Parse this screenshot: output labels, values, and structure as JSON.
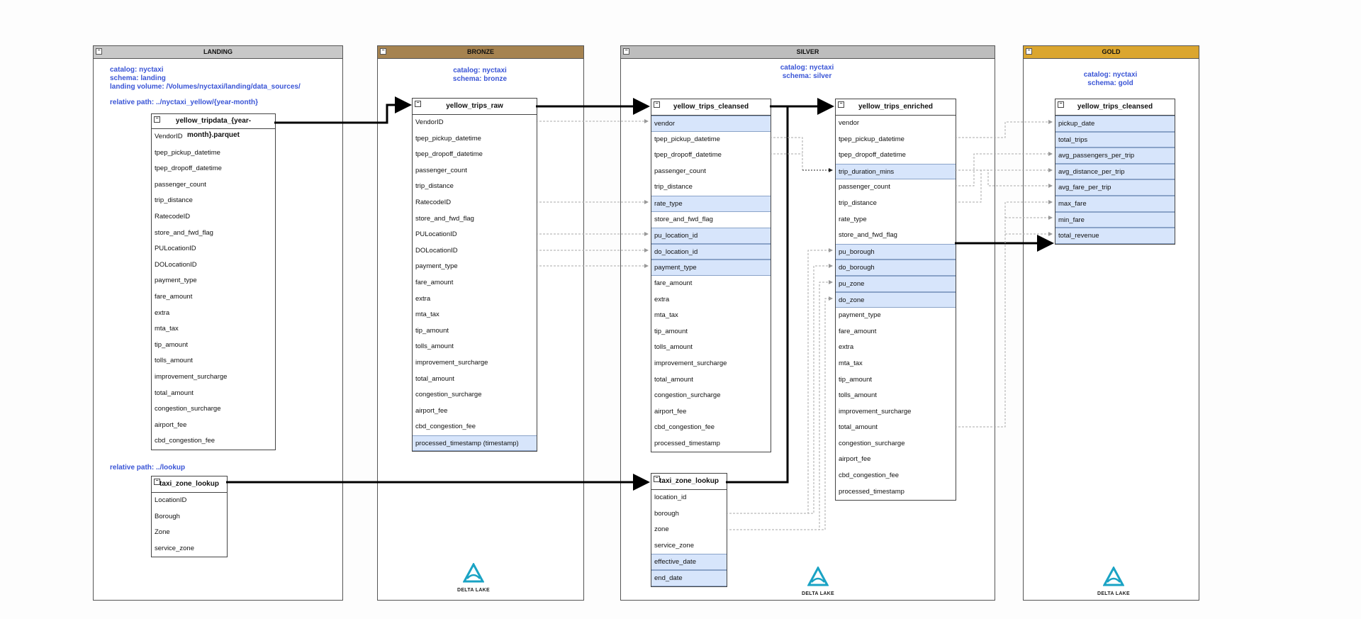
{
  "lanes": {
    "landing": {
      "title": "LANDING"
    },
    "bronze": {
      "title": "BRONZE"
    },
    "silver": {
      "title": "SILVER"
    },
    "gold": {
      "title": "GOLD"
    }
  },
  "landing": {
    "catalog": "catalog: nyctaxi",
    "schema": "schema: landing",
    "volume": "landing volume: /Volumes/nyctaxi/landing/data_sources/",
    "path_yellow": "relative path: ../nyctaxi_yellow/{year-month}",
    "path_lookup": "relative path: ../lookup"
  },
  "bronze": {
    "catalog": "catalog: nyctaxi",
    "schema": "schema: bronze"
  },
  "silver": {
    "catalog": "catalog: nyctaxi",
    "schema": "schema: silver"
  },
  "gold": {
    "catalog": "catalog: nyctaxi",
    "schema": "schema: gold"
  },
  "delta_lake": "DELTA LAKE",
  "tables": {
    "landing_yellow": {
      "title": "yellow_tripdata_{year-month}.parquet",
      "rows": [
        "VendorID",
        "tpep_pickup_datetime",
        "tpep_dropoff_datetime",
        "passenger_count",
        "trip_distance",
        "RatecodeID",
        "store_and_fwd_flag",
        "PULocationID",
        "DOLocationID",
        "payment_type",
        "fare_amount",
        "extra",
        "mta_tax",
        "tip_amount",
        "tolls_amount",
        "improvement_surcharge",
        "total_amount",
        "congestion_surcharge",
        "airport_fee",
        "cbd_congestion_fee"
      ]
    },
    "landing_lookup": {
      "title": "taxi_zone_lookup",
      "rows": [
        "LocationID",
        "Borough",
        "Zone",
        "service_zone"
      ]
    },
    "bronze_raw": {
      "title": "yellow_trips_raw",
      "rows": [
        "VendorID",
        "tpep_pickup_datetime",
        "tpep_dropoff_datetime",
        "passenger_count",
        "trip_distance",
        "RatecodeID",
        "store_and_fwd_flag",
        "PULocationID",
        "DOLocationID",
        "payment_type",
        "fare_amount",
        "extra",
        "mta_tax",
        "tip_amount",
        "tolls_amount",
        "improvement_surcharge",
        "total_amount",
        "congestion_surcharge",
        "airport_fee",
        "cbd_congestion_fee",
        "processed_timestamp   (timestamp)"
      ],
      "highlight": [
        20
      ]
    },
    "silver_cleansed": {
      "title": "yellow_trips_cleansed",
      "rows": [
        "vendor",
        "tpep_pickup_datetime",
        "tpep_dropoff_datetime",
        "passenger_count",
        "trip_distance",
        "rate_type",
        "store_and_fwd_flag",
        "pu_location_id",
        "do_location_id",
        "payment_type",
        "fare_amount",
        "extra",
        "mta_tax",
        "tip_amount",
        "tolls_amount",
        "improvement_surcharge",
        "total_amount",
        "congestion_surcharge",
        "airport_fee",
        "cbd_congestion_fee",
        "processed_timestamp"
      ],
      "highlight": [
        0,
        5,
        7,
        8,
        9
      ]
    },
    "silver_enriched": {
      "title": "yellow_trips_enriched",
      "rows": [
        "vendor",
        "tpep_pickup_datetime",
        "tpep_dropoff_datetime",
        "trip_duration_mins",
        "passenger_count",
        "trip_distance",
        "rate_type",
        "store_and_fwd_flag",
        "pu_borough",
        "do_borough",
        "pu_zone",
        "do_zone",
        "payment_type",
        "fare_amount",
        "extra",
        "mta_tax",
        "tip_amount",
        "tolls_amount",
        "improvement_surcharge",
        "total_amount",
        "congestion_surcharge",
        "airport_fee",
        "cbd_congestion_fee",
        "processed_timestamp"
      ],
      "highlight": [
        3,
        8,
        9,
        10,
        11
      ]
    },
    "silver_lookup": {
      "title": "taxi_zone_lookup",
      "rows": [
        "location_id",
        "borough",
        "zone",
        "service_zone",
        "effective_date",
        "end_date"
      ],
      "highlight": [
        4,
        5
      ]
    },
    "gold_cleansed": {
      "title": "yellow_trips_cleansed",
      "rows": [
        "pickup_date",
        "total_trips",
        "avg_passengers_per_trip",
        "avg_distance_per_trip",
        "avg_fare_per_trip",
        "max_fare",
        "min_fare",
        "total_revenue"
      ],
      "highlight": [
        0,
        1,
        2,
        3,
        4,
        5,
        6,
        7
      ]
    }
  },
  "colors": {
    "landing_head": "#c8c8c8",
    "bronze_head": "#a68350",
    "silver_head": "#bdbdbd",
    "gold_head": "#dba62f",
    "meta_text": "#3a55d6",
    "highlight": "#d7e5fb",
    "delta": "#1aa3c4"
  },
  "icons": [
    "collapse-toggle-icon",
    "delta-lake-logo-icon"
  ]
}
